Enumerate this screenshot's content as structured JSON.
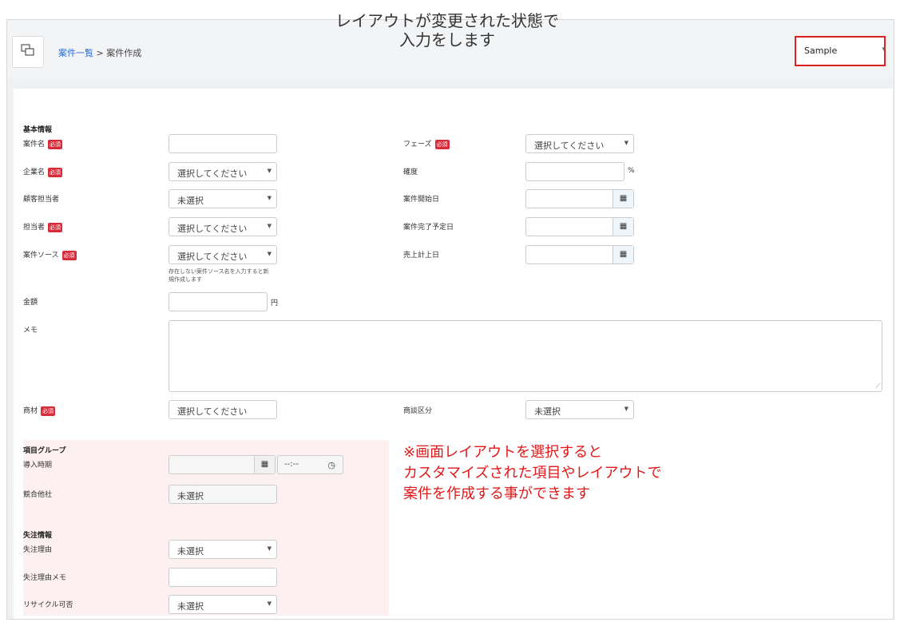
{
  "callout_top": [
    "レイアウトが変更された状態で",
    "入力をします"
  ],
  "breadcrumb": {
    "link": "案件一覧",
    "sep": ">",
    "current": "案件作成"
  },
  "layout_select": {
    "value": "Sample"
  },
  "sections": {
    "basic": "基本情報",
    "group": "項目グループ",
    "lost": "失注情報"
  },
  "required_badge": "必須",
  "left_fields": {
    "name": {
      "label": "案件名"
    },
    "company": {
      "label": "企業名",
      "value": "選択してください"
    },
    "contact": {
      "label": "顧客担当者",
      "value": "未選択"
    },
    "owner": {
      "label": "担当者",
      "value": "選択してください"
    },
    "source": {
      "label": "案件ソース",
      "value": "選択してください",
      "help": [
        "存在しない案件ソース名を入力すると新",
        "規作成します"
      ]
    },
    "amount": {
      "label": "金額",
      "unit": "円"
    },
    "memo": {
      "label": "メモ"
    },
    "product": {
      "label": "商材",
      "value": "選択してください"
    }
  },
  "right_fields": {
    "phase": {
      "label": "フェーズ",
      "value": "選択してください"
    },
    "probability": {
      "label": "確度",
      "unit": "%"
    },
    "start_date": {
      "label": "案件開始日"
    },
    "end_date": {
      "label": "案件完了予定日"
    },
    "sales_date": {
      "label": "売上計上日"
    },
    "deal_type": {
      "label": "商談区分",
      "value": "未選択"
    }
  },
  "group_fields": {
    "intro": {
      "label": "導入時期",
      "time_value": "--:--"
    },
    "competitor": {
      "label": "競合他社",
      "value": "未選択"
    }
  },
  "lost_fields": {
    "reason": {
      "label": "失注理由",
      "value": "未選択"
    },
    "reason_memo": {
      "label": "失注理由メモ"
    },
    "recycle": {
      "label": "リサイクル可否",
      "value": "未選択"
    }
  },
  "callout_red": [
    "※画面レイアウトを選択すると",
    "カスタマイズされた項目やレイアウトで",
    "案件を作成する事ができます"
  ],
  "icons": {
    "logo": "chat-bubbles-icon",
    "calendar": "calendar-icon",
    "clock": "clock-icon",
    "caret": "caret-down-icon"
  },
  "colors": {
    "link": "#2a6bd1",
    "required": "#d92c3a",
    "highlight_border": "#e02020",
    "callout": "#e01818",
    "group_bg": "#fdf0f0"
  }
}
